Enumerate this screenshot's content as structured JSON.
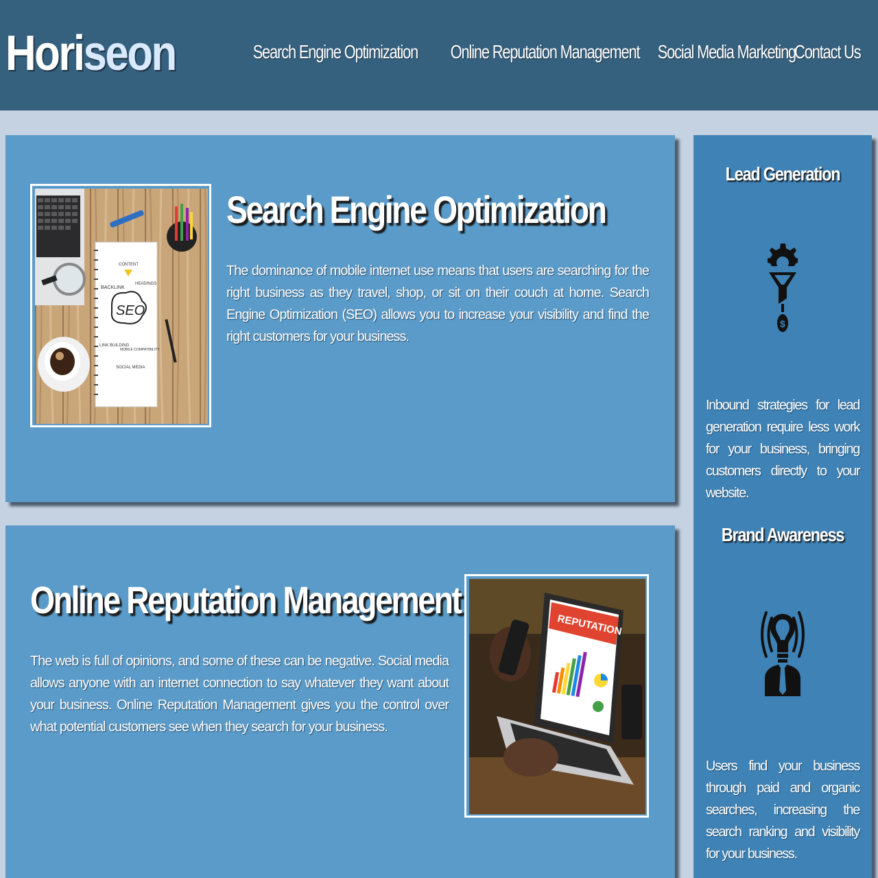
{
  "header": {
    "logo_main": "Hori",
    "logo_accent": "seon",
    "nav": [
      "Search Engine Optimization",
      "Online Reputation Management",
      "Social Media Marketing",
      "Contact Us"
    ]
  },
  "content": {
    "seo": {
      "title": "Search Engine Optimization",
      "text": "The dominance of mobile internet use means that users are searching for the right business as they travel, shop, or sit on their couch at home. Search Engine Optimization (SEO) allows you to increase your visibility and find the right customers for your business.",
      "image_text": {
        "center": "SEO",
        "labels": [
          "CONTENT",
          "BACKLINK",
          "HEADINGS",
          "LINK BUILDING",
          "MOBILE COMPATIBILITY",
          "SOCIAL MEDIA"
        ]
      }
    },
    "reputation": {
      "title": "Online Reputation Management",
      "text": "The web is full of opinions, and some of these can be negative. Social media allows anyone with an internet connection to say whatever they want about your business. Online Reputation Management gives you the control over what potential customers see when they search for your business.",
      "image_text": "REPUTATION"
    }
  },
  "sidebar": {
    "lead": {
      "title": "Lead Generation",
      "icon": "lead-generation-funnel-icon",
      "text": "Inbound strategies for lead generation require less work for your business, bringing customers directly to your website."
    },
    "brand": {
      "title": "Brand Awareness",
      "icon": "brand-awareness-lightbulb-icon",
      "text": "Users find your business through paid and organic searches, increasing the search ranking and visibility for your business."
    }
  },
  "colors": {
    "header_bg": "#35617f",
    "page_bg": "#c5d2e1",
    "card_bg": "#5a9bc9",
    "sidebar_bg": "#3e82b6"
  }
}
